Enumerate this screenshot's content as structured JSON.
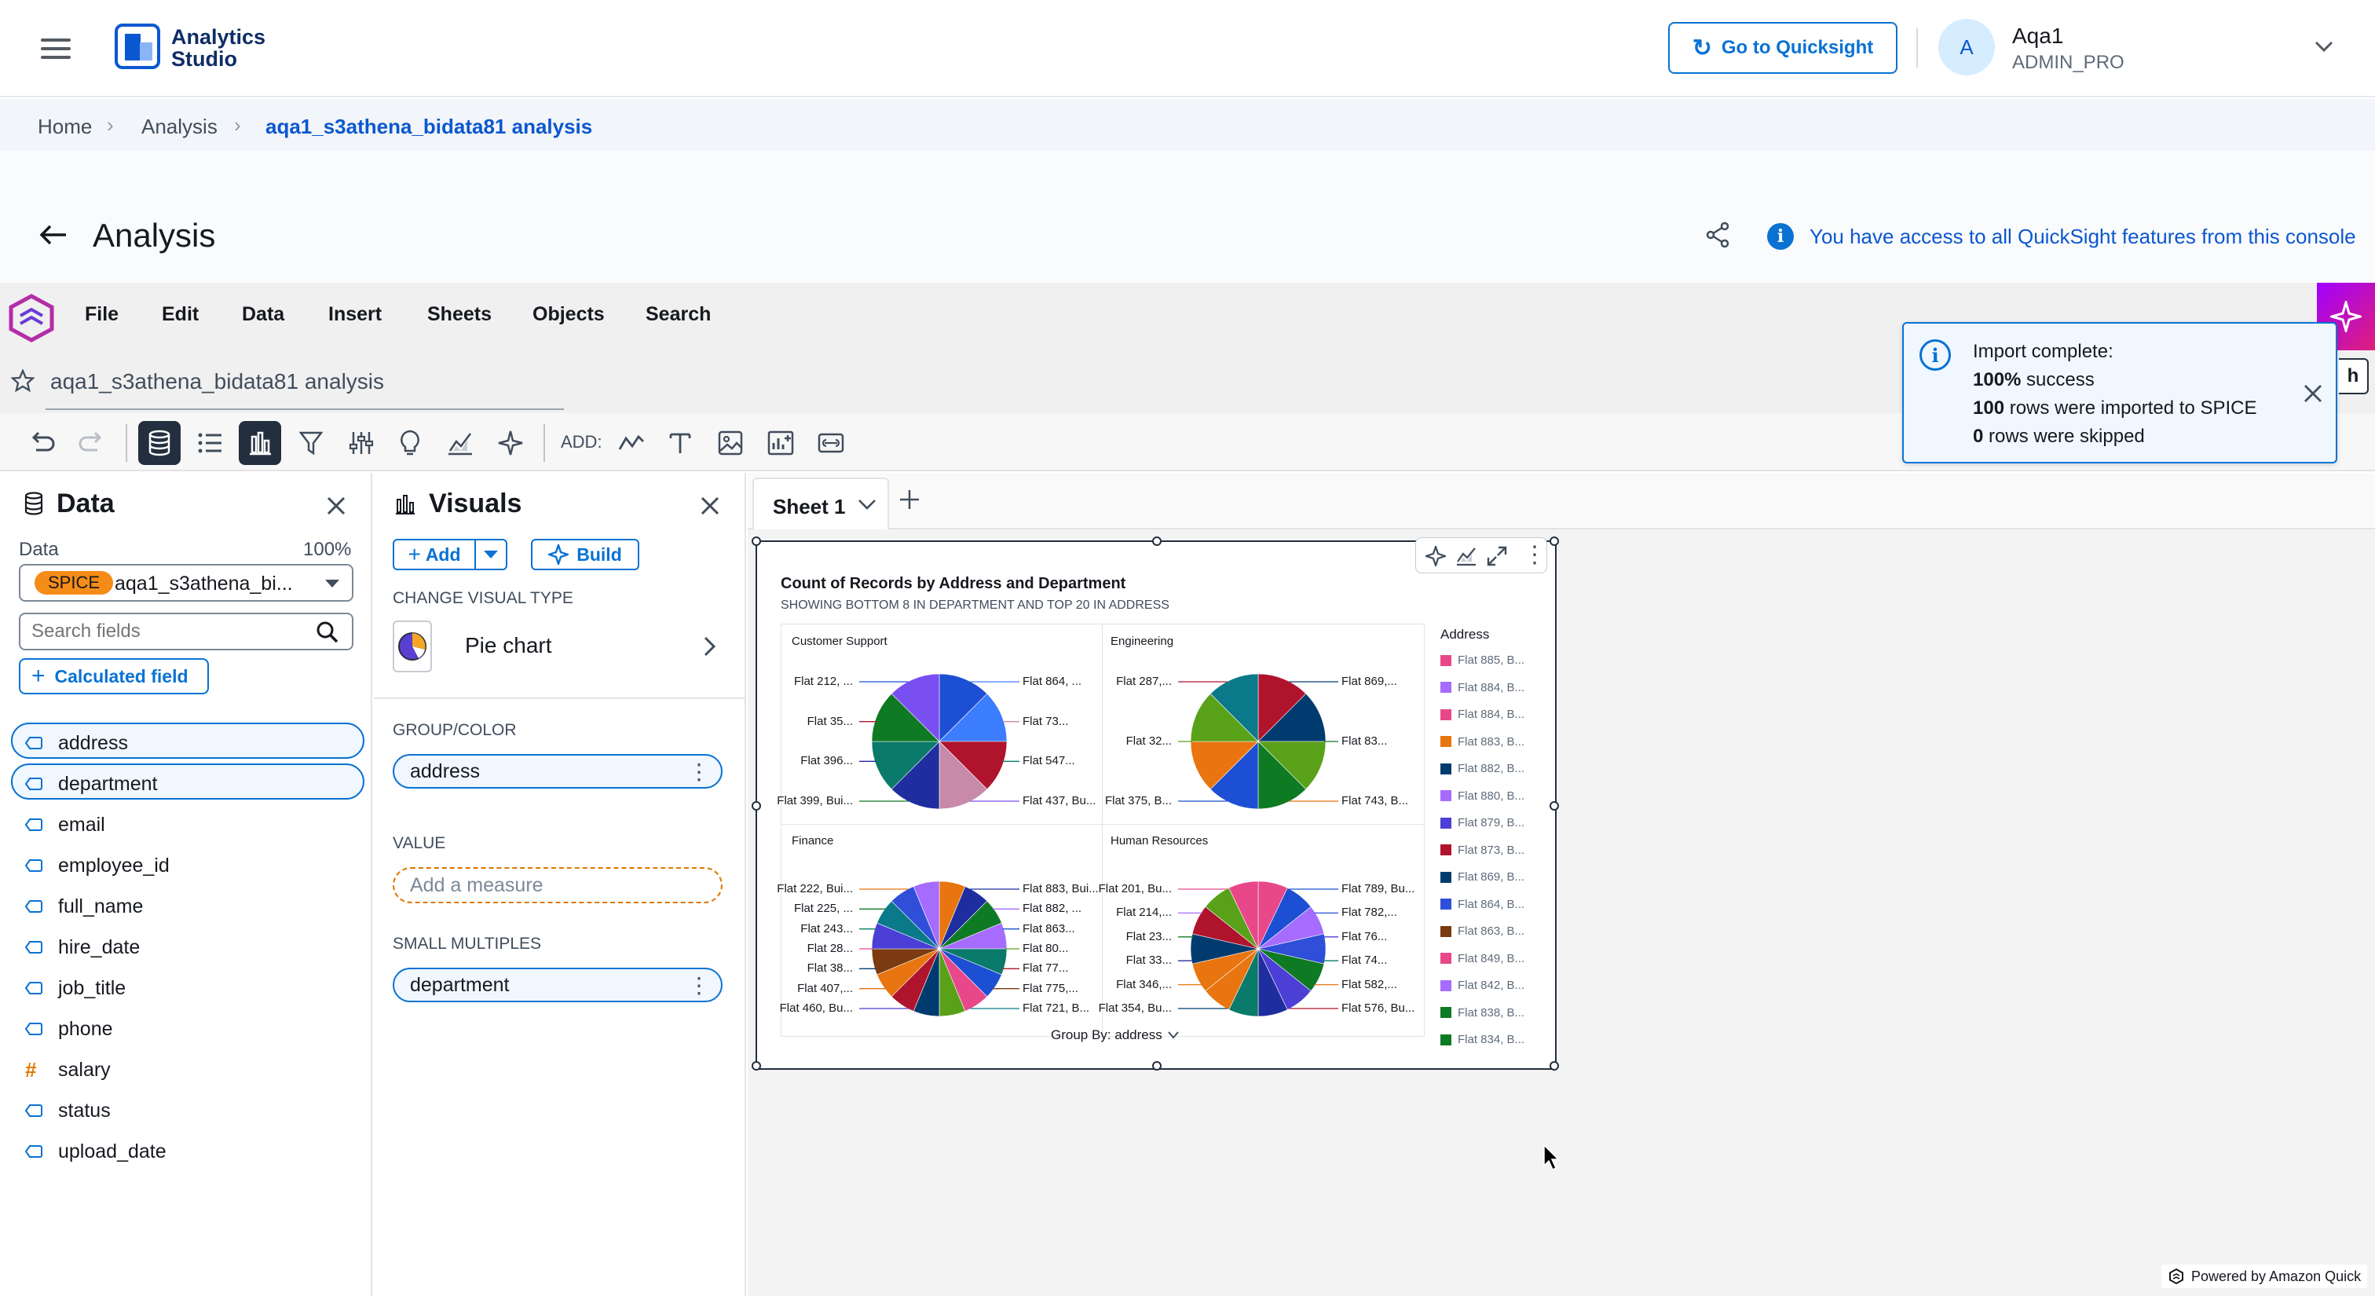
{
  "app": {
    "name_line1": "Analytics",
    "name_line2": "Studio"
  },
  "header": {
    "quicksight_button": "Go to Quicksight",
    "user_initial": "A",
    "user_name": "Aqa1",
    "user_role": "ADMIN_PRO"
  },
  "breadcrumb": [
    "Home",
    "Analysis",
    "aqa1_s3athena_bidata81 analysis"
  ],
  "page": {
    "title": "Analysis",
    "info_text": "You have access to all QuickSight features from this console"
  },
  "menu": [
    "File",
    "Edit",
    "Data",
    "Insert",
    "Sheets",
    "Objects",
    "Search"
  ],
  "analysis_name": "aqa1_s3athena_bidata81 analysis",
  "toolbar": {
    "add_label": "ADD:"
  },
  "toast": {
    "title": "Import complete:",
    "line1_bold": "100%",
    "line1_rest": " success",
    "line2_bold": "100",
    "line2_rest": " rows were imported to SPICE",
    "line3_bold": "0",
    "line3_rest": " rows were skipped",
    "partial_button": "h"
  },
  "data_panel": {
    "title": "Data",
    "data_label": "Data",
    "spice_pct": "100%",
    "spice_badge": "SPICE",
    "dataset_name": "aqa1_s3athena_bi...",
    "search_placeholder": "Search fields",
    "calc_field_button": "Calculated field",
    "fields": [
      {
        "name": "address",
        "type": "dim",
        "selected": true
      },
      {
        "name": "department",
        "type": "dim",
        "selected": true
      },
      {
        "name": "email",
        "type": "dim",
        "selected": false
      },
      {
        "name": "employee_id",
        "type": "dim",
        "selected": false
      },
      {
        "name": "full_name",
        "type": "dim",
        "selected": false
      },
      {
        "name": "hire_date",
        "type": "dim",
        "selected": false
      },
      {
        "name": "job_title",
        "type": "dim",
        "selected": false
      },
      {
        "name": "phone",
        "type": "dim",
        "selected": false
      },
      {
        "name": "salary",
        "type": "measure",
        "selected": false
      },
      {
        "name": "status",
        "type": "dim",
        "selected": false
      },
      {
        "name": "upload_date",
        "type": "dim",
        "selected": false
      }
    ]
  },
  "visuals_panel": {
    "title": "Visuals",
    "add_button": "Add",
    "build_button": "Build",
    "change_type_label": "CHANGE VISUAL TYPE",
    "visual_type": "Pie chart",
    "group_label": "GROUP/COLOR",
    "group_field": "address",
    "value_label": "VALUE",
    "value_placeholder": "Add a measure",
    "small_multiples_label": "SMALL MULTIPLES",
    "small_multiples_field": "department"
  },
  "sheet": {
    "tab_name": "Sheet 1"
  },
  "footer": {
    "powered_by": "Powered by Amazon Quick"
  },
  "chart_data": {
    "type": "pie",
    "title": "Count of Records by Address and Department",
    "subtitle": "SHOWING BOTTOM 8 IN DEPARTMENT AND TOP 20 IN ADDRESS",
    "group_by_label": "Group By: address",
    "legend_title": "Address",
    "legend": [
      {
        "label": "Flat 885, B...",
        "color": "#e8488a"
      },
      {
        "label": "Flat 884, B...",
        "color": "#a66bff"
      },
      {
        "label": "Flat 884, B...",
        "color": "#e8488a"
      },
      {
        "label": "Flat 883, B...",
        "color": "#e8750f"
      },
      {
        "label": "Flat 882, B...",
        "color": "#003b6f"
      },
      {
        "label": "Flat 880, B...",
        "color": "#a66bff"
      },
      {
        "label": "Flat 879, B...",
        "color": "#4b3fd6"
      },
      {
        "label": "Flat 873, B...",
        "color": "#b0142c"
      },
      {
        "label": "Flat 869, B...",
        "color": "#003b6f"
      },
      {
        "label": "Flat 864, B...",
        "color": "#2f4fd8"
      },
      {
        "label": "Flat 863, B...",
        "color": "#7b3a10"
      },
      {
        "label": "Flat 849, B...",
        "color": "#e8488a"
      },
      {
        "label": "Flat 842, B...",
        "color": "#a66bff"
      },
      {
        "label": "Flat 838, B...",
        "color": "#0e7a23"
      },
      {
        "label": "Flat 834, B...",
        "color": "#0e7a23"
      }
    ],
    "panels": [
      {
        "name": "Customer Support",
        "colors": [
          "#1c4fd3",
          "#3c7cff",
          "#b0142c",
          "#c78aa8",
          "#1f2e9e",
          "#0a7a6a",
          "#0e7a23",
          "#7a4ff2"
        ],
        "values": [
          1,
          1,
          1,
          1,
          1,
          1,
          1,
          1
        ],
        "labels_left": [
          "Flat 212, ...",
          "Flat 35...",
          "Flat 396...",
          "Flat 399, Bui..."
        ],
        "labels_right": [
          "Flat 864, ...",
          "Flat 73...",
          "Flat 547...",
          "Flat 437, Bu..."
        ]
      },
      {
        "name": "Engineering",
        "colors": [
          "#b0142c",
          "#003b6f",
          "#5aa11a",
          "#0e7a23",
          "#1c4fd3",
          "#e8750f",
          "#5aa11a",
          "#0a7a8a"
        ],
        "values": [
          1,
          1,
          1,
          1,
          1,
          1,
          1,
          1
        ],
        "labels_left": [
          "Flat 287,...",
          "Flat 32...",
          "Flat 375, B..."
        ],
        "labels_right": [
          "Flat 869,...",
          "Flat 83...",
          "Flat 743, B..."
        ]
      },
      {
        "name": "Finance",
        "colors": [
          "#e8750f",
          "#1f2e9e",
          "#0e7a23",
          "#a66bff",
          "#0a7a6a",
          "#1c4fd3",
          "#e8488a",
          "#5aa11a",
          "#003b6f",
          "#b0142c",
          "#e8750f",
          "#7b3a10",
          "#4b3fd6",
          "#0a7a8a",
          "#2f4fd8",
          "#a66bff"
        ],
        "values": [
          1,
          1,
          1,
          1,
          1,
          1,
          1,
          1,
          1,
          1,
          1,
          1,
          1,
          1,
          1,
          1
        ],
        "labels_left": [
          "Flat 222, Bui...",
          "Flat 225, ...",
          "Flat 243...",
          "Flat 28...",
          "Flat 38...",
          "Flat 407,...",
          "Flat 460, Bu..."
        ],
        "labels_right": [
          "Flat 883, Bui...",
          "Flat 882, ...",
          "Flat 863...",
          "Flat 80...",
          "Flat 77...",
          "Flat 775,...",
          "Flat 721, B..."
        ]
      },
      {
        "name": "Human Resources",
        "colors": [
          "#e8488a",
          "#1c4fd3",
          "#a66bff",
          "#2f4fd8",
          "#0e7a23",
          "#4b3fd6",
          "#1f2e9e",
          "#0a7a6a",
          "#e8750f",
          "#e8750f",
          "#003b6f",
          "#b0142c",
          "#5aa11a",
          "#e8488a"
        ],
        "values": [
          1,
          1,
          1,
          1,
          1,
          1,
          1,
          1,
          1,
          1,
          1,
          1,
          1,
          1
        ],
        "labels_left": [
          "Flat 201, Bu...",
          "Flat 214,...",
          "Flat 23...",
          "Flat 33...",
          "Flat 346,...",
          "Flat 354, Bu..."
        ],
        "labels_right": [
          "Flat 789, Bu...",
          "Flat 782,...",
          "Flat 76...",
          "Flat 74...",
          "Flat 582,...",
          "Flat 576, Bu..."
        ]
      }
    ]
  }
}
